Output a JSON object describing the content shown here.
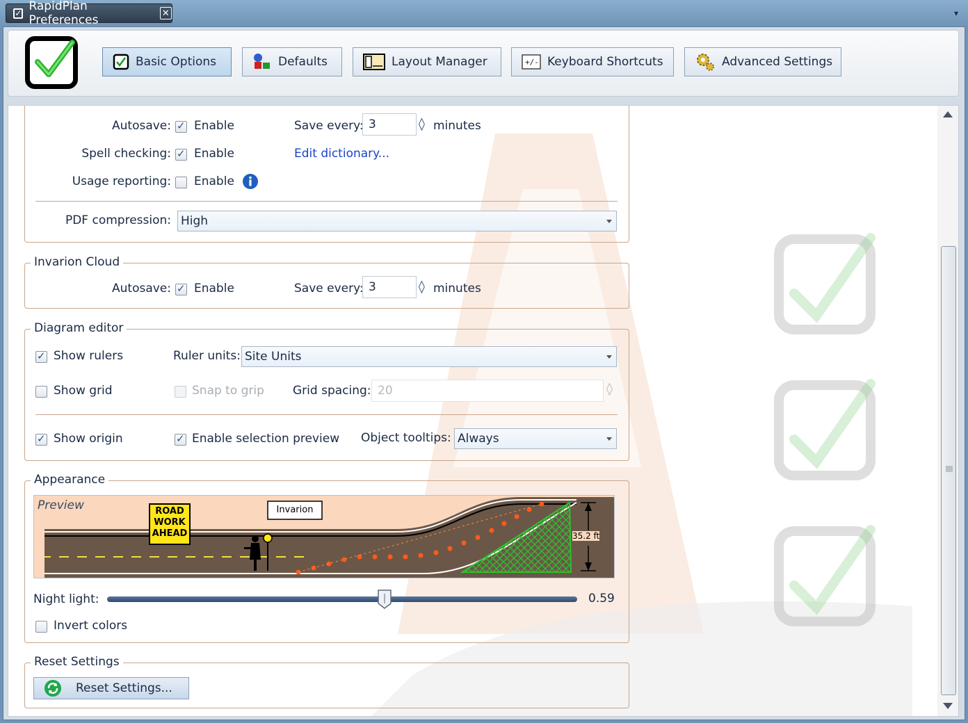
{
  "window": {
    "tab_title": "RapidPlan Preferences",
    "close_glyph": "✕",
    "menu_glyph": "▾",
    "checkbox_glyph": "✓"
  },
  "toolbar": {
    "buttons": [
      {
        "label": "Basic Options",
        "icon": "checkbox-icon",
        "active": true
      },
      {
        "label": "Defaults",
        "icon": "defaults-icon",
        "active": false
      },
      {
        "label": "Layout Manager",
        "icon": "layout-icon",
        "active": false
      },
      {
        "label": "Keyboard Shortcuts",
        "icon": "keyboard-icon",
        "active": false
      },
      {
        "label": "Advanced Settings",
        "icon": "gears-icon",
        "active": false
      }
    ]
  },
  "general": {
    "autosave_label": "Autosave:",
    "enable": "Enable",
    "save_every_label": "Save every:",
    "save_every_value": "3",
    "minutes": "minutes",
    "spell_label": "Spell checking:",
    "edit_dictionary": "Edit dictionary...",
    "usage_label": "Usage reporting:",
    "pdf_label": "PDF compression:",
    "pdf_value": "High",
    "autosave_enabled": true,
    "spell_enabled": true,
    "usage_enabled": false
  },
  "cloud": {
    "title": "Invarion Cloud",
    "autosave_label": "Autosave:",
    "enable": "Enable",
    "save_every_label": "Save every:",
    "save_every_value": "3",
    "minutes": "minutes",
    "autosave_enabled": true
  },
  "diagram": {
    "title": "Diagram editor",
    "show_rulers": "Show rulers",
    "ruler_units_label": "Ruler units:",
    "ruler_units_value": "Site Units",
    "show_grid": "Show grid",
    "snap_to_grip": "Snap to grip",
    "grid_spacing_label": "Grid spacing:",
    "grid_spacing_value": "20",
    "show_origin": "Show origin",
    "enable_selection_preview": "Enable selection preview",
    "object_tooltips_label": "Object tooltips:",
    "object_tooltips_value": "Always",
    "show_rulers_checked": true,
    "show_grid_checked": false,
    "snap_checked": false,
    "show_origin_checked": true,
    "selection_preview_checked": true
  },
  "appearance": {
    "title": "Appearance",
    "preview_label": "Preview",
    "sign_line1": "ROAD",
    "sign_line2": "WORK",
    "sign_line3": "AHEAD",
    "invarion_box": "Invarion",
    "dimension": "35.2 ft",
    "night_light_label": "Night light:",
    "night_light_value": "0.59",
    "night_light_fraction": 0.59,
    "invert_colors": "Invert colors",
    "invert_checked": false
  },
  "reset": {
    "title": "Reset Settings",
    "button_label": "Reset Settings..."
  },
  "colors": {
    "accent": "#6f94b7",
    "group_border": "#c8a58a",
    "preview_bg": "#fad7bd",
    "link": "#1a45c7"
  }
}
